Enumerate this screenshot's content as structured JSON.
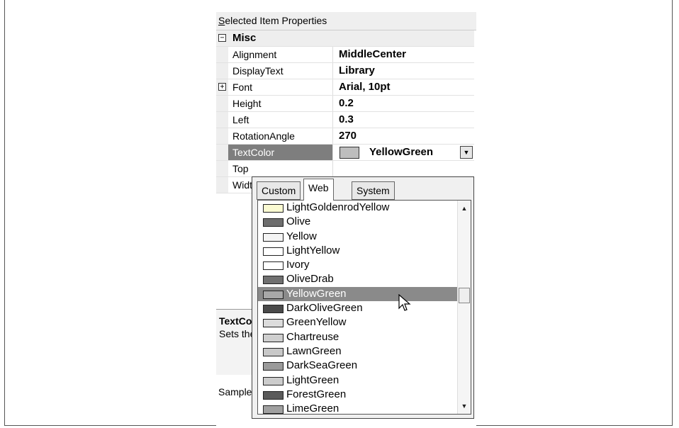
{
  "pane": {
    "title_first": "S",
    "title_rest": "elected Item Properties"
  },
  "category": {
    "toggle": "⊟",
    "name": "Misc"
  },
  "properties": [
    {
      "name": "Alignment",
      "value": "MiddleCenter"
    },
    {
      "name": "DisplayText",
      "value": "Library"
    },
    {
      "name": "Font",
      "value": "Arial, 10pt",
      "expand": "+"
    },
    {
      "name": "Height",
      "value": "0.2"
    },
    {
      "name": "Left",
      "value": "0.3"
    },
    {
      "name": "RotationAngle",
      "value": "270"
    }
  ],
  "selected_property": {
    "name": "TextColor",
    "value": "YellowGreen",
    "swatch_color": "#bdbdbd"
  },
  "hidden_properties": [
    {
      "name": "Top"
    },
    {
      "name": "Width"
    }
  ],
  "description": {
    "title": "TextColor",
    "text": "Sets the"
  },
  "sample_label": "Sample",
  "color_picker": {
    "tabs": [
      {
        "label": "Custom"
      },
      {
        "label": "Web",
        "active": true
      },
      {
        "label": "System"
      }
    ],
    "colors": [
      {
        "name": "LightGoldenrodYellow",
        "swatch": "#fafad2"
      },
      {
        "name": "Olive",
        "swatch": "#6e6e6e"
      },
      {
        "name": "Yellow",
        "swatch": "#f4f4f4"
      },
      {
        "name": "LightYellow",
        "swatch": "#ffffff"
      },
      {
        "name": "Ivory",
        "swatch": "#ffffff"
      },
      {
        "name": "OliveDrab",
        "swatch": "#707070"
      },
      {
        "name": "YellowGreen",
        "swatch": "#a8a8a8",
        "selected": true
      },
      {
        "name": "DarkOliveGreen",
        "swatch": "#4a4a4a"
      },
      {
        "name": "GreenYellow",
        "swatch": "#dcdcdc"
      },
      {
        "name": "Chartreuse",
        "swatch": "#cfcfcf"
      },
      {
        "name": "LawnGreen",
        "swatch": "#c8c8c8"
      },
      {
        "name": "DarkSeaGreen",
        "swatch": "#9a9a9a"
      },
      {
        "name": "LightGreen",
        "swatch": "#cccccc"
      },
      {
        "name": "ForestGreen",
        "swatch": "#5a5a5a"
      },
      {
        "name": "LimeGreen",
        "swatch": "#a0a0a0"
      }
    ]
  },
  "icons": {
    "dropdown": "chevron-down-icon",
    "cursor": "mouse-pointer-icon"
  }
}
